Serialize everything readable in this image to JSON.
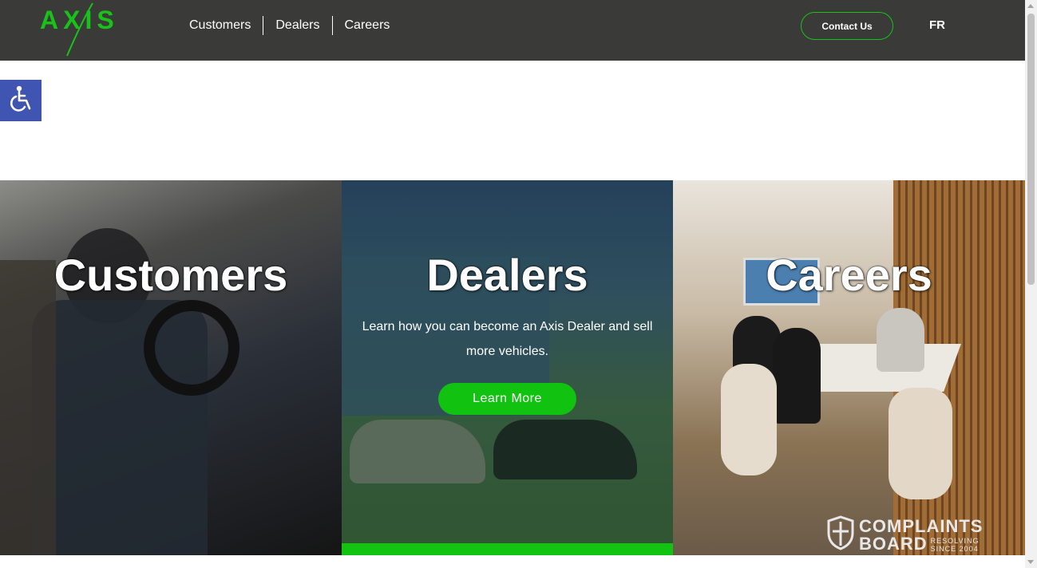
{
  "header": {
    "logo_text": "AXIS",
    "nav": [
      "Customers",
      "Dealers",
      "Careers"
    ],
    "contact_label": "Contact Us",
    "lang_label": "FR"
  },
  "accessibility": {
    "icon": "wheelchair-icon"
  },
  "panels": [
    {
      "title": "Customers"
    },
    {
      "title": "Dealers",
      "text": "Learn how you can become an Axis Dealer and sell more vehicles.",
      "button": "Learn More"
    },
    {
      "title": "Careers"
    }
  ],
  "watermark": {
    "line1": "COMPLAINTS",
    "line2a": "BOARD",
    "line2b_top": "RESOLVING",
    "line2b_bottom": "SINCE 2004"
  },
  "colors": {
    "header_bg": "#3a3a38",
    "brand_green": "#12c312",
    "accessibility_blue": "#4054b2"
  }
}
